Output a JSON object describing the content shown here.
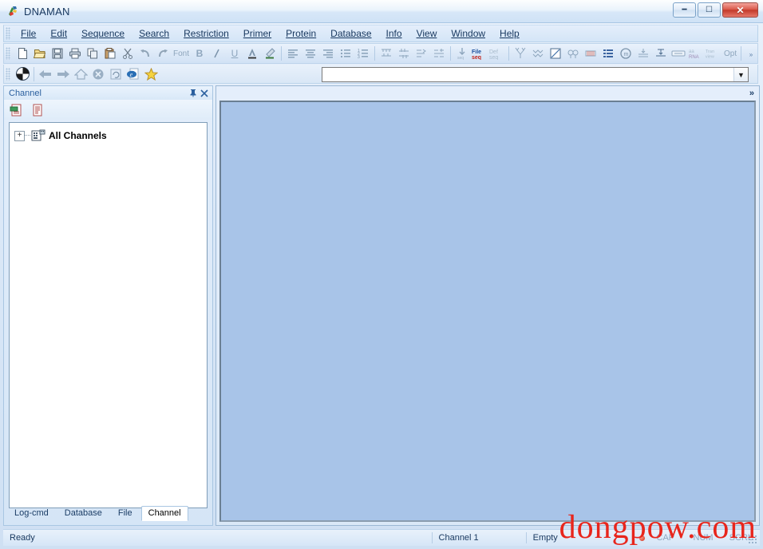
{
  "window": {
    "title": "DNAMAN",
    "app_icon": "dnaman-logo-icon",
    "minimize_label": "–",
    "maximize_label": "□",
    "close_label": "✕"
  },
  "menu": {
    "items": [
      {
        "label": "File",
        "accel": "F"
      },
      {
        "label": "Edit",
        "accel": "E"
      },
      {
        "label": "Sequence",
        "accel": "S"
      },
      {
        "label": "Search",
        "accel": "e"
      },
      {
        "label": "Restriction",
        "accel": "R"
      },
      {
        "label": "Primer",
        "accel": "P"
      },
      {
        "label": "Protein",
        "accel": "t"
      },
      {
        "label": "Database",
        "accel": "D"
      },
      {
        "label": "Info",
        "accel": "I"
      },
      {
        "label": "View",
        "accel": "V"
      },
      {
        "label": "Window",
        "accel": "W"
      },
      {
        "label": "Help",
        "accel": "H"
      }
    ]
  },
  "toolbar": {
    "overflow_label": "»",
    "buttons": [
      {
        "name": "new-icon",
        "tip": "New"
      },
      {
        "name": "open-folder-icon",
        "tip": "Open"
      },
      {
        "name": "save-icon",
        "tip": "Save"
      },
      {
        "name": "print-icon",
        "tip": "Print"
      },
      {
        "name": "copy-icon",
        "tip": "Copy"
      },
      {
        "name": "paste-icon",
        "tip": "Paste"
      },
      {
        "name": "cut-scissors-icon",
        "tip": "Cut"
      },
      {
        "name": "undo-icon",
        "tip": "Undo"
      },
      {
        "name": "redo-icon",
        "tip": "Redo"
      },
      {
        "name": "font-label",
        "tip": "Font",
        "text": "Font"
      },
      {
        "name": "bold-icon",
        "tip": "Bold",
        "text": "B"
      },
      {
        "name": "italic-icon",
        "tip": "Italic",
        "text": "I"
      },
      {
        "name": "underline-icon",
        "tip": "Underline",
        "text": "U"
      },
      {
        "name": "font-color-icon",
        "tip": "Font Color",
        "text": "A"
      },
      {
        "name": "highlight-color-icon",
        "tip": "Highlight"
      },
      {
        "name": "align-left-icon",
        "tip": "Align Left"
      },
      {
        "name": "align-center-icon",
        "tip": "Align Center"
      },
      {
        "name": "align-right-icon",
        "tip": "Align Right"
      },
      {
        "name": "bullet-list-icon",
        "tip": "Bulleted List"
      },
      {
        "name": "number-list-icon",
        "tip": "Numbered List"
      },
      {
        "name": "restriction-map-icon",
        "tip": "Restriction Map"
      },
      {
        "name": "alignment-icon",
        "tip": "Alignment"
      },
      {
        "name": "primer-design-icon",
        "tip": "Primer Design"
      },
      {
        "name": "sequence-assembly-icon",
        "tip": "Assembly"
      },
      {
        "name": "load-seq-icon",
        "tip": "Load Sequence",
        "text": "seq"
      },
      {
        "name": "file-seq-icon",
        "tip": "File Seq",
        "text": "File seq"
      },
      {
        "name": "def-seq-icon",
        "tip": "Def Seq",
        "text": "Def seq"
      },
      {
        "name": "phylogenetic-tree-icon",
        "tip": "Phylogenetic Tree"
      },
      {
        "name": "multiple-alignment-icon",
        "tip": "Multiple Alignment"
      },
      {
        "name": "dot-plot-icon",
        "tip": "Dot Plot"
      },
      {
        "name": "homology-search-icon",
        "tip": "Homology Search"
      },
      {
        "name": "sequence-view-icon",
        "tip": "Sequence View"
      },
      {
        "name": "list-view-icon",
        "tip": "List View"
      },
      {
        "name": "plasmid-map-icon",
        "tip": "Plasmid Map"
      },
      {
        "name": "translate-icon",
        "tip": "Translate"
      },
      {
        "name": "restriction-cut-icon",
        "tip": "Restriction Cut"
      },
      {
        "name": "label-box-icon",
        "tip": "Label"
      },
      {
        "name": "rna-icon",
        "tip": "RNA",
        "text": "RNA"
      },
      {
        "name": "tran-view-icon",
        "tip": "Tran View",
        "text": "Tran view"
      },
      {
        "name": "options-icon",
        "tip": "Options",
        "text": "Opt"
      }
    ]
  },
  "navbar": {
    "buttons": [
      {
        "name": "channel-globe-icon",
        "tip": "Channel"
      },
      {
        "name": "back-arrow-icon",
        "tip": "Back"
      },
      {
        "name": "forward-arrow-icon",
        "tip": "Forward"
      },
      {
        "name": "home-icon",
        "tip": "Home"
      },
      {
        "name": "stop-icon",
        "tip": "Stop"
      },
      {
        "name": "refresh-icon",
        "tip": "Refresh"
      },
      {
        "name": "internet-explorer-icon",
        "tip": "Browse"
      },
      {
        "name": "favorites-star-icon",
        "tip": "Favorites"
      }
    ],
    "address": {
      "value": "",
      "placeholder": "",
      "dropdown_glyph": "▼"
    }
  },
  "panel": {
    "caption": "Channel",
    "pin_glyph": "⚓",
    "close_glyph": "✕",
    "tools": [
      {
        "name": "new-channel-icon",
        "tip": "New Channel"
      },
      {
        "name": "channel-properties-icon",
        "tip": "Properties"
      }
    ],
    "tree": {
      "expander": "+",
      "icon": "all-channels-icon",
      "label": "All Channels"
    },
    "tabs": [
      {
        "label": "Log-cmd",
        "active": false
      },
      {
        "label": "Database",
        "active": false
      },
      {
        "label": "File",
        "active": false
      },
      {
        "label": "Channel",
        "active": true
      }
    ]
  },
  "mdi": {
    "chevron": "»"
  },
  "statusbar": {
    "ready": "Ready",
    "channel": "Channel 1",
    "empty": "Empty",
    "indicators": [
      {
        "label": "CAP",
        "active": false
      },
      {
        "label": "NUM",
        "active": false
      },
      {
        "label": "SCRL",
        "active": false
      }
    ]
  },
  "watermark": {
    "text": "dongpow.com"
  },
  "colors": {
    "title_text": "#17375e",
    "menu_text": "#17375e",
    "panel_caption": "#2a5f9e",
    "mdi_client": "#a8c4e8",
    "watermark": "#e8261c",
    "close_button": "#c33a2a"
  }
}
